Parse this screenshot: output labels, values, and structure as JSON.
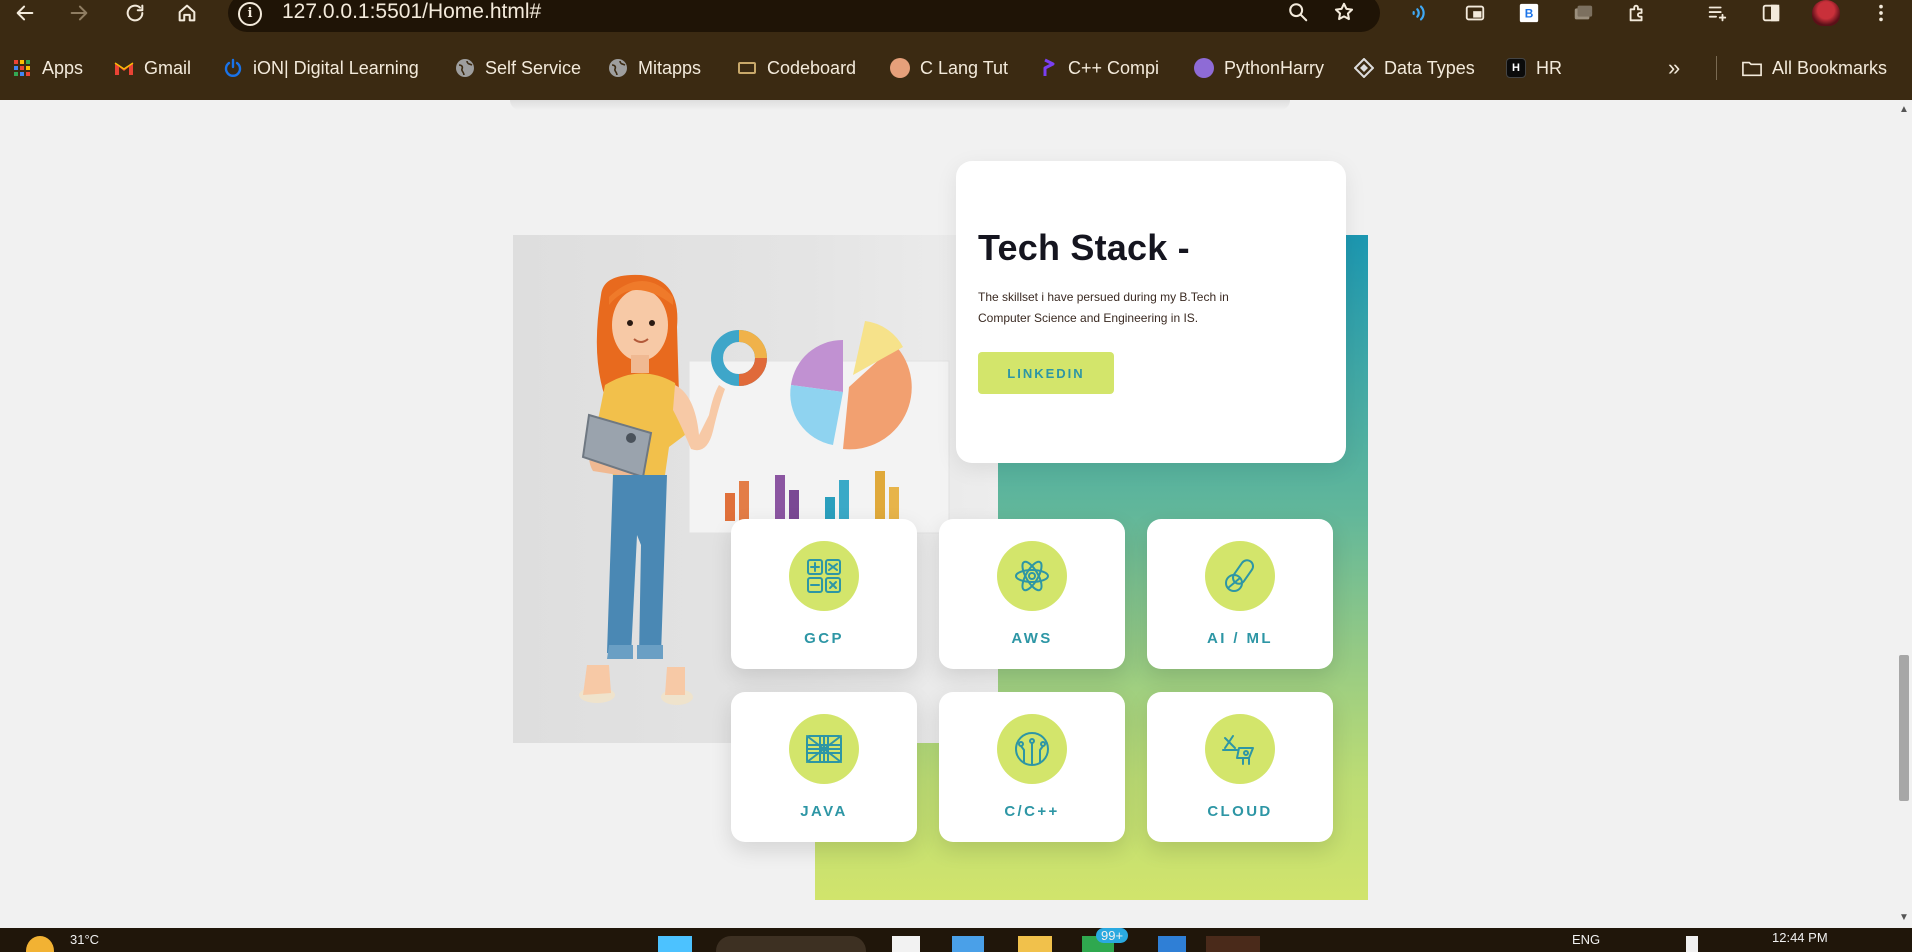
{
  "browser": {
    "url": "127.0.0.1:5501/Home.html#",
    "bookmarks": [
      {
        "label": "Apps",
        "icon": "apps-grid-icon",
        "color": "#e8453c"
      },
      {
        "label": "Gmail",
        "icon": "gmail-icon",
        "color": "#ea4335"
      },
      {
        "label": "iON| Digital Learning",
        "icon": "power-icon",
        "color": "#1a73e8"
      },
      {
        "label": "Self Service",
        "icon": "globe-icon",
        "color": "#9e9e9e"
      },
      {
        "label": "Mitapps",
        "icon": "globe-icon",
        "color": "#9e9e9e"
      },
      {
        "label": "Codeboard",
        "icon": "codeboard-icon",
        "color": "#c8a86a"
      },
      {
        "label": "C Lang Tut",
        "icon": "avatar-icon",
        "color": "#e6a07a"
      },
      {
        "label": "C++ Compi",
        "icon": "compiler-icon",
        "color": "#7a3ff2"
      },
      {
        "label": "PythonHarry",
        "icon": "avatar-icon",
        "color": "#8e6bd6"
      },
      {
        "label": "Data Types",
        "icon": "diamond-icon",
        "color": "#dddddd"
      },
      {
        "label": "HR",
        "icon": "hackerrank-icon",
        "color": "#0b0b0b"
      }
    ],
    "all_bookmarks_label": "All Bookmarks"
  },
  "page": {
    "intro": {
      "title": "Tech Stack -",
      "description": "The skillset i have persued during my B.Tech in Computer Science and Engineering in IS.",
      "button_label": "LINKEDIN"
    },
    "skills": [
      {
        "label": "GCP",
        "icon": "grid-icon"
      },
      {
        "label": "AWS",
        "icon": "atom-icon"
      },
      {
        "label": "AI / ML",
        "icon": "capsule-icon"
      },
      {
        "label": "JAVA",
        "icon": "union-jack-icon"
      },
      {
        "label": "C/C++",
        "icon": "circuit-icon"
      },
      {
        "label": "CLOUD",
        "icon": "hardware-icon"
      }
    ],
    "colors": {
      "accent_lime": "#d3e56b",
      "accent_teal": "#2d96a5"
    }
  },
  "taskbar": {
    "weather": "31°C",
    "notification_badge": "99+",
    "language": "ENG",
    "time": "12:44 PM"
  }
}
